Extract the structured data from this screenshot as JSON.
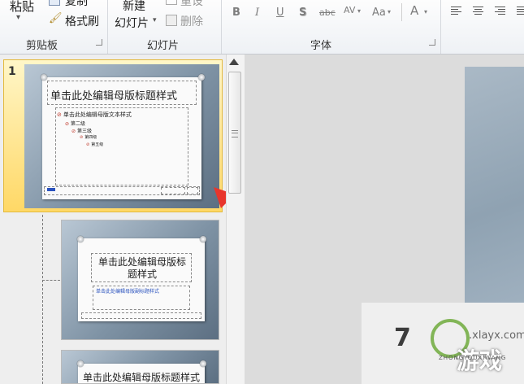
{
  "ribbon": {
    "clipboard": {
      "paste": "粘贴",
      "copy": "复制",
      "format_painter": "格式刷",
      "label": "剪贴板"
    },
    "slides": {
      "new_slide_line1": "新建",
      "new_slide_line2": "幻灯片",
      "reset": "重设",
      "delete": "删除",
      "label": "幻灯片"
    },
    "font": {
      "bold": "B",
      "italic": "I",
      "underline": "U",
      "shadow": "S",
      "strikethrough": "abc",
      "spacing": "AV",
      "change_case": "Aa",
      "font_color": "A",
      "label": "字体"
    }
  },
  "slide_panel": {
    "slide1": {
      "number": "1",
      "title": "单击此处编辑母版标题样式",
      "body_levels": [
        "单击此处编辑母版文本样式",
        "第二级",
        "第三级",
        "第四级",
        "第五级"
      ]
    },
    "slide2": {
      "title": "单击此处编辑母版标题样式",
      "subtitle": "单击此处编辑母版副标题样式"
    },
    "slide3": {
      "title": "单击此处编辑母版标题样式"
    }
  },
  "watermark": {
    "digits": "7",
    "domain": ".xlayx.com",
    "brand": "游戏",
    "pinyin": "ZHONGYOUXIWANG"
  }
}
